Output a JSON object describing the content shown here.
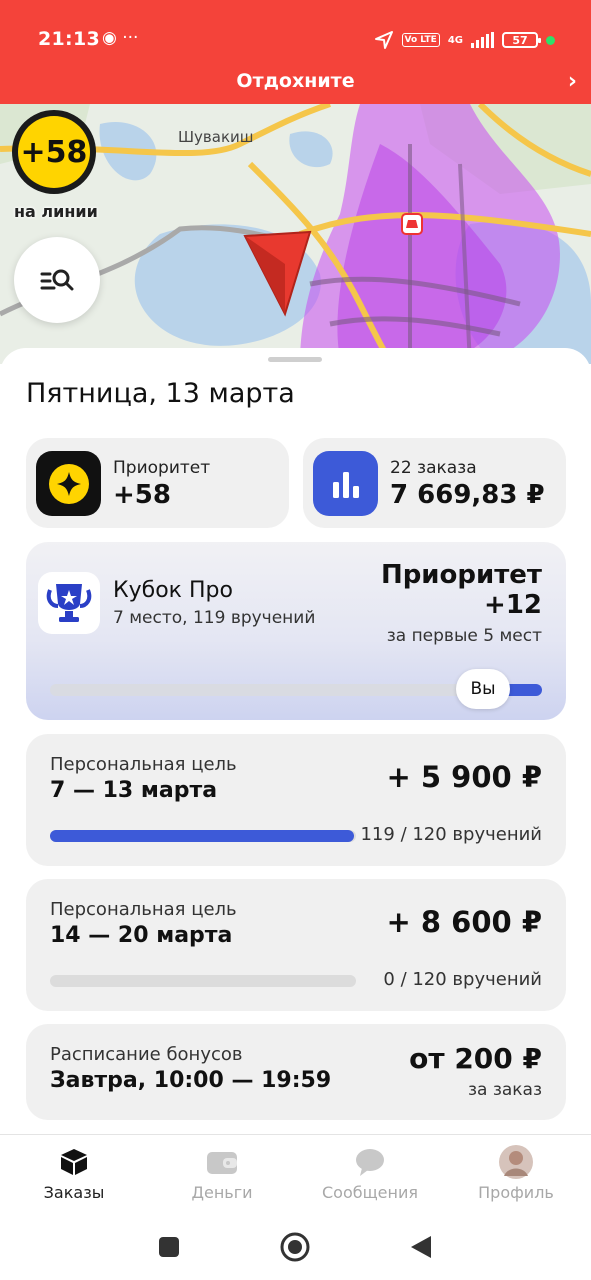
{
  "status_bar": {
    "time": "21:13",
    "left_icons": "◉ ···",
    "network": "4G",
    "battery": "57",
    "vo_badge": "Vo LTE"
  },
  "banner": {
    "title": "Отдохните",
    "chevron": "›"
  },
  "map": {
    "place_label": "Шувакиш",
    "priority_value": "+58",
    "on_line_label": "на линии"
  },
  "date_title": "Пятница, 13 марта",
  "priority_card": {
    "label": "Приоритет",
    "value": "+58"
  },
  "orders_card": {
    "label": "22 заказа",
    "value": "7 669,83 ₽"
  },
  "cup_card": {
    "title": "Кубок Про",
    "subtitle": "7 место, 119 вручений",
    "reward_label": "Приоритет",
    "reward_value": "+12",
    "reward_condition": "за первые 5 мест",
    "you_label": "Вы",
    "progress": 0.92
  },
  "goals": [
    {
      "label": "Персональная цель",
      "dates": "7 — 13 марта",
      "amount": "+ 5 900 ₽",
      "progress_text": "119 / 120 вручений",
      "progress": 0.992
    },
    {
      "label": "Персональная цель",
      "dates": "14 — 20 марта",
      "amount": "+ 8 600 ₽",
      "progress_text": "0 / 120 вручений",
      "progress": 0
    }
  ],
  "schedule_card": {
    "label": "Расписание бонусов",
    "time": "Завтра, 10:00 — 19:59",
    "amount": "от 200 ₽",
    "subtitle": "за заказ"
  },
  "bottom_nav": [
    {
      "label": "Заказы",
      "icon": "orders-box-icon",
      "active": true
    },
    {
      "label": "Деньги",
      "icon": "wallet-icon",
      "active": false
    },
    {
      "label": "Сообщения",
      "icon": "chat-bubble-icon",
      "active": false
    },
    {
      "label": "Профиль",
      "icon": "avatar-icon",
      "active": false
    }
  ],
  "colors": {
    "brand_red": "#f4433a",
    "accent_blue": "#3d5ad8",
    "priority_yellow": "#ffd400",
    "heatmap_purple": "#c84cf0"
  }
}
